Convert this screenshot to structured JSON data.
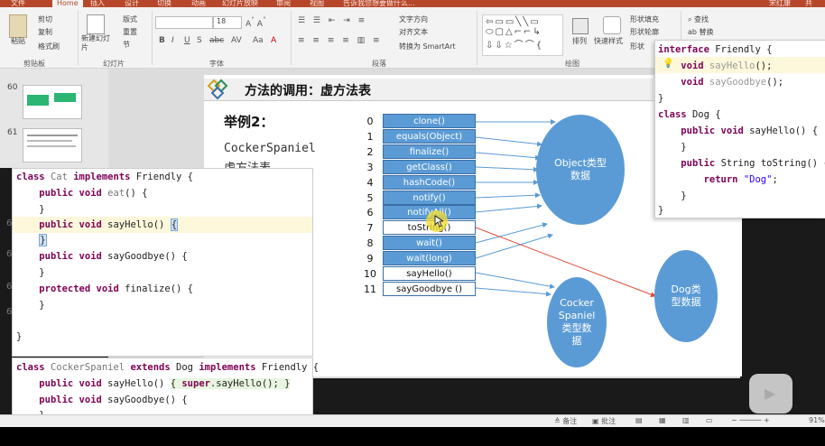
{
  "ribbon": {
    "tabs": [
      "文件",
      "Home",
      "插入",
      "设计",
      "切换",
      "动画",
      "幻灯片放映",
      "审阅",
      "视图",
      "告诉我您想要做什么...",
      "宋红康",
      "共"
    ],
    "active_tab": "Home",
    "clipboard": {
      "cut": "剪切",
      "copy": "复制",
      "paste": "粘贴",
      "format_painter": "格式刷",
      "label": "剪贴板"
    },
    "slides": {
      "new_slide": "新建幻灯片",
      "layout": "版式",
      "reset": "重置",
      "section": "节",
      "label": "幻灯片"
    },
    "font": {
      "size": "18",
      "label": "字体"
    },
    "paragraph": {
      "text_direction": "文字方向",
      "align_text": "对齐文本",
      "smartart": "转换为 SmartArt",
      "label": "段落"
    },
    "drawing": {
      "arrange": "排列",
      "quick_styles": "快速样式",
      "shape_fill": "形状填充",
      "shape_outline": "形状轮廓",
      "shape_effects": "形状",
      "label": "绘图"
    },
    "editing": {
      "find": "查找",
      "replace": "替换"
    }
  },
  "thumbnails": [
    {
      "num": "60"
    },
    {
      "num": "61"
    }
  ],
  "slide": {
    "title": "方法的调用：虚方法表",
    "example": "举例2：",
    "class_name": "CockerSpaniel",
    "vtable_label": "虚方法表",
    "methods": [
      {
        "idx": "0",
        "name": "clone()",
        "style": "blue"
      },
      {
        "idx": "1",
        "name": "equals(Object)",
        "style": "blue"
      },
      {
        "idx": "2",
        "name": "finalize()",
        "style": "blue"
      },
      {
        "idx": "3",
        "name": "getClass()",
        "style": "blue"
      },
      {
        "idx": "4",
        "name": "hashCode()",
        "style": "blue"
      },
      {
        "idx": "5",
        "name": "notify()",
        "style": "blue"
      },
      {
        "idx": "6",
        "name": "notifyAll()",
        "style": "blue"
      },
      {
        "idx": "7",
        "name": "toString()",
        "style": "white"
      },
      {
        "idx": "8",
        "name": "wait()",
        "style": "blue"
      },
      {
        "idx": "9",
        "name": "wait(long)",
        "style": "blue"
      },
      {
        "idx": "10",
        "name": "sayHello()",
        "style": "white"
      },
      {
        "idx": "11",
        "name": "sayGoodbye ()",
        "style": "white"
      }
    ],
    "bubbles": {
      "object": "Object类型\n数据",
      "cocker": "Cocker\nSpaniel\n类型数\n据",
      "dog": "Dog类\n型数据"
    }
  },
  "code_interface": [
    "interface Friendly {",
    "    void sayHello();",
    "    void sayGoodbye();",
    "}",
    "class Dog {",
    "    public void sayHello() {",
    "    }",
    "    public String toString() {",
    "        return \"Dog\";",
    "    }",
    "}"
  ],
  "code_cat": [
    "class Cat implements Friendly {",
    "    public void eat() {",
    "    }",
    "    public void sayHello() {",
    "    }",
    "    public void sayGoodbye() {",
    "    }",
    "    protected void finalize() {",
    "    }",
    "",
    "}"
  ],
  "code_cocker": [
    "class CockerSpaniel extends Dog implements Friendly {",
    "    public void sayHello() { super.sayHello(); }",
    "    public void sayGoodbye() {",
    "    }"
  ],
  "gutter_marks": [
    "6",
    "6",
    "6",
    "6"
  ],
  "status": {
    "notes": "备注",
    "comments": "批注",
    "zoom": "91%"
  },
  "colors": {
    "ribbon_accent": "#b7472a",
    "table_blue": "#5b9bd5",
    "keyword": "#7f0055"
  }
}
